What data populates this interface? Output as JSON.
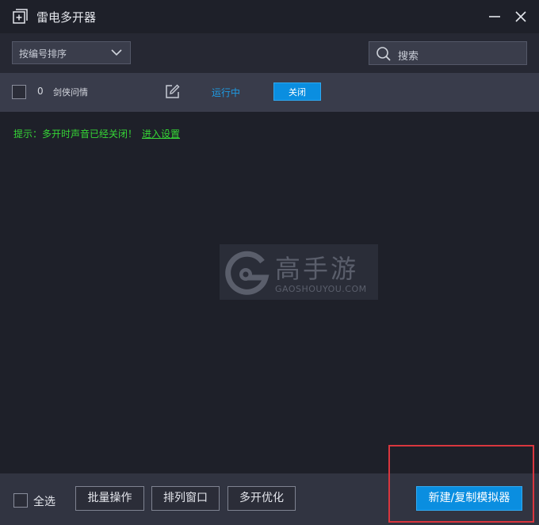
{
  "window": {
    "title": "雷电多开器",
    "icons": {
      "app": "plus-square-icon",
      "minimize": "minimize-icon",
      "close": "close-icon"
    }
  },
  "toolbar": {
    "sort_select": {
      "value": "按编号排序",
      "icon": "chevron-down-icon"
    },
    "search": {
      "placeholder": "搜索",
      "icon": "search-icon"
    }
  },
  "instances": [
    {
      "index": "0",
      "name": "剑侠问情",
      "status": "运行中",
      "action_label": "关闭",
      "edit_icon": "edit-icon",
      "checked": false
    }
  ],
  "tip": {
    "text": "提示：多开时声音已经关闭！",
    "link": "进入设置"
  },
  "watermark": {
    "brand_cn": "高手游",
    "brand_en": "GAOSHOUYOU.COM",
    "logo": "g-logo-icon"
  },
  "footer": {
    "select_all_label": "全选",
    "buttons": [
      "批量操作",
      "排列窗口",
      "多开优化"
    ],
    "primary_button": "新建/复制模拟器"
  },
  "colors": {
    "background": "#1e2029",
    "row_background": "#393c4b",
    "accent_blue": "#0a8ee0",
    "status_blue": "#1e9be4",
    "tip_green": "#36d636",
    "highlight_red": "#d9363e"
  }
}
